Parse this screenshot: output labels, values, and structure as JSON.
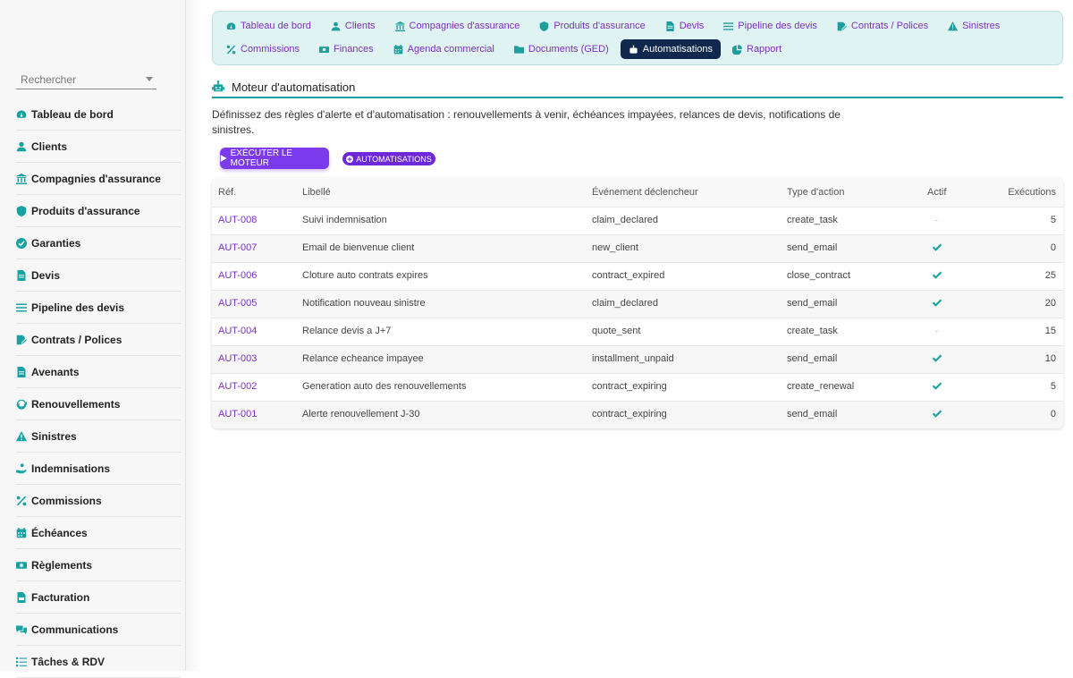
{
  "search": {
    "placeholder": "Rechercher"
  },
  "sidebar": {
    "items": [
      {
        "label": "Tableau de bord",
        "icon": "dashboard-icon"
      },
      {
        "label": "Clients",
        "icon": "user-icon"
      },
      {
        "label": "Compagnies d'assurance",
        "icon": "bank-icon"
      },
      {
        "label": "Produits d'assurance",
        "icon": "shield-icon"
      },
      {
        "label": "Garanties",
        "icon": "check-circle-icon"
      },
      {
        "label": "Devis",
        "icon": "file-icon"
      },
      {
        "label": "Pipeline des devis",
        "icon": "bars-icon"
      },
      {
        "label": "Contrats / Polices",
        "icon": "file-signature-icon"
      },
      {
        "label": "Avenants",
        "icon": "file-icon"
      },
      {
        "label": "Renouvellements",
        "icon": "refresh-icon"
      },
      {
        "label": "Sinistres",
        "icon": "warning-icon"
      },
      {
        "label": "Indemnisations",
        "icon": "hand-holding-icon"
      },
      {
        "label": "Commissions",
        "icon": "percent-icon"
      },
      {
        "label": "Échéances",
        "icon": "calendar-icon"
      },
      {
        "label": "Règlements",
        "icon": "money-icon"
      },
      {
        "label": "Facturation",
        "icon": "file-invoice-icon"
      },
      {
        "label": "Communications",
        "icon": "comments-icon"
      },
      {
        "label": "Tâches & RDV",
        "icon": "tasks-icon"
      }
    ]
  },
  "topnav": {
    "row1": [
      {
        "label": "Tableau de bord",
        "icon": "dashboard-icon"
      },
      {
        "label": "Clients",
        "icon": "user-icon"
      },
      {
        "label": "Compagnies d'assurance",
        "icon": "bank-icon"
      },
      {
        "label": "Produits d'assurance",
        "icon": "shield-icon"
      },
      {
        "label": "Devis",
        "icon": "file-icon"
      },
      {
        "label": "Pipeline des devis",
        "icon": "bars-icon"
      },
      {
        "label": "Contrats / Polices",
        "icon": "file-signature-icon"
      },
      {
        "label": "Sinistres",
        "icon": "warning-icon"
      }
    ],
    "row2": [
      {
        "label": "Commissions",
        "icon": "percent-icon"
      },
      {
        "label": "Finances",
        "icon": "money-icon"
      },
      {
        "label": "Agenda commercial",
        "icon": "calendar-icon"
      },
      {
        "label": "Documents (GED)",
        "icon": "folder-icon"
      },
      {
        "label": "Automatisations",
        "icon": "robot-icon",
        "active": true
      },
      {
        "label": "Rapport",
        "icon": "pie-chart-icon"
      }
    ]
  },
  "main": {
    "title": "Moteur d'automatisation",
    "description": "Définissez des règles d'alerte et d'automatisation : renouvellements à venir, échéances impayées, relances de devis, notifications de sinistres.",
    "run_button": "EXÉCUTER LE MOTEUR",
    "automations_button": "AUTOMATISATIONS"
  },
  "table": {
    "headers": {
      "ref": "Réf.",
      "label": "Libellé",
      "event": "Événement déclencheur",
      "action": "Type d'action",
      "active": "Actif",
      "executions": "Exécutions"
    },
    "rows": [
      {
        "ref": "AUT-008",
        "label": "Suivi indemnisation",
        "event": "claim_declared",
        "action": "create_task",
        "active": false,
        "inactive_mark": "-",
        "executions": "5"
      },
      {
        "ref": "AUT-007",
        "label": "Email de bienvenue client",
        "event": "new_client",
        "action": "send_email",
        "active": true,
        "inactive_mark": "",
        "executions": "0"
      },
      {
        "ref": "AUT-006",
        "label": "Cloture auto contrats expires",
        "event": "contract_expired",
        "action": "close_contract",
        "active": true,
        "inactive_mark": "",
        "executions": "25"
      },
      {
        "ref": "AUT-005",
        "label": "Notification nouveau sinistre",
        "event": "claim_declared",
        "action": "send_email",
        "active": true,
        "inactive_mark": "",
        "executions": "20"
      },
      {
        "ref": "AUT-004",
        "label": "Relance devis a J+7",
        "event": "quote_sent",
        "action": "create_task",
        "active": false,
        "inactive_mark": "-",
        "executions": "15"
      },
      {
        "ref": "AUT-003",
        "label": "Relance echeance impayee",
        "event": "installment_unpaid",
        "action": "send_email",
        "active": true,
        "inactive_mark": "",
        "executions": "10"
      },
      {
        "ref": "AUT-002",
        "label": "Generation auto des renouvellements",
        "event": "contract_expiring",
        "action": "create_renewal",
        "active": true,
        "inactive_mark": "",
        "executions": "5"
      },
      {
        "ref": "AUT-001",
        "label": "Alerte renouvellement J-30",
        "event": "contract_expiring",
        "action": "send_email",
        "active": true,
        "inactive_mark": "",
        "executions": "0"
      }
    ]
  },
  "colors": {
    "accent": "#17a2a2",
    "link": "#7b2fbe",
    "active_tab": "#10284d",
    "button": "#7c3aed"
  }
}
